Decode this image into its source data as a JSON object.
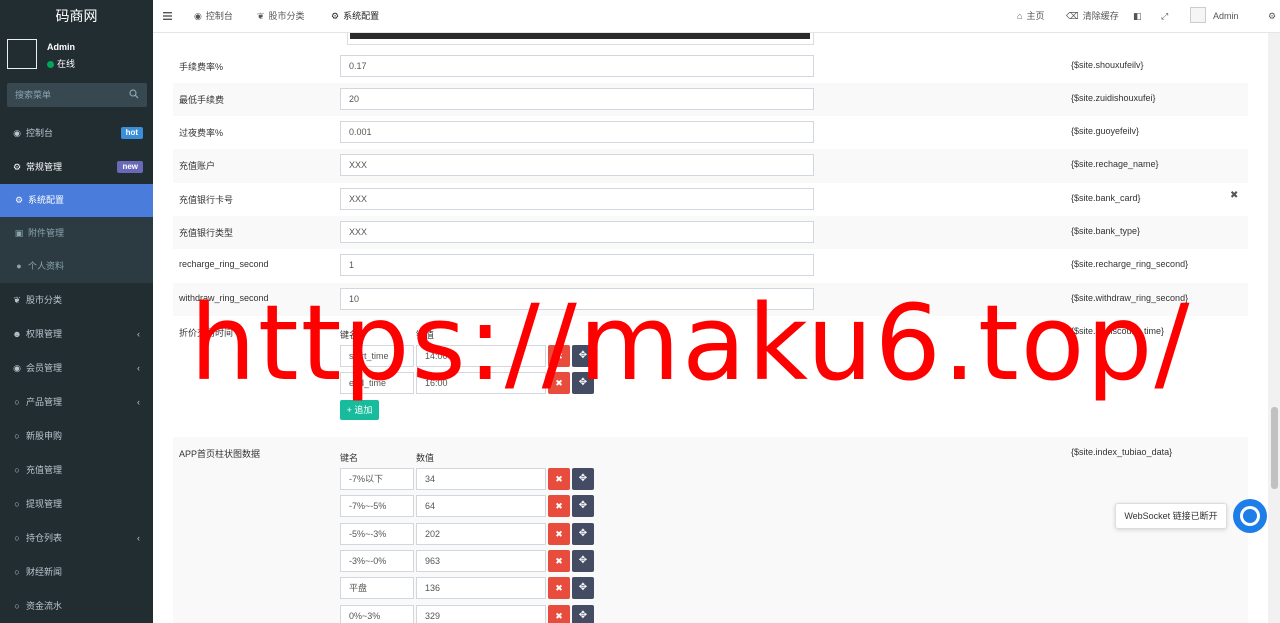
{
  "app": {
    "logo": "码商网"
  },
  "user": {
    "name": "Admin",
    "status": "在线"
  },
  "search": {
    "placeholder": "搜索菜单"
  },
  "sidebar": {
    "items": [
      {
        "label": "控制台",
        "icon": "dashboard-icon",
        "badge": "hot"
      },
      {
        "label": "常规管理",
        "icon": "cogs-icon",
        "badge": "new"
      },
      {
        "label": "系统配置",
        "icon": "gear-icon",
        "active": true,
        "sub": true
      },
      {
        "label": "附件管理",
        "icon": "file-image-icon",
        "sub": true
      },
      {
        "label": "个人资料",
        "icon": "user-icon",
        "sub": true
      },
      {
        "label": "股市分类",
        "icon": "leaf-icon"
      },
      {
        "label": "权限管理",
        "icon": "group-icon",
        "chevron": true
      },
      {
        "label": "会员管理",
        "icon": "user-circle-icon",
        "chevron": true
      },
      {
        "label": "产品管理",
        "icon": "circle-icon",
        "chevron": true
      },
      {
        "label": "新股申购",
        "icon": "circle-icon"
      },
      {
        "label": "充值管理",
        "icon": "circle-icon"
      },
      {
        "label": "提现管理",
        "icon": "circle-icon"
      },
      {
        "label": "持仓列表",
        "icon": "circle-icon",
        "chevron": true
      },
      {
        "label": "财经新闻",
        "icon": "circle-icon"
      },
      {
        "label": "资金流水",
        "icon": "circle-icon"
      }
    ]
  },
  "header": {
    "tabs": [
      {
        "label": "控制台",
        "icon": "dashboard-icon"
      },
      {
        "label": "股市分类",
        "icon": "leaf-icon"
      },
      {
        "label": "系统配置",
        "icon": "gear-icon"
      }
    ],
    "home_label": "主页",
    "clear_cache_label": "清除缓存",
    "admin_label": "Admin"
  },
  "config_rows": [
    {
      "label": "手续费率%",
      "value": "0.17",
      "var": "{$site.shouxufeilv}"
    },
    {
      "label": "最低手续费",
      "value": "20",
      "var": "{$site.zuidishouxufei}"
    },
    {
      "label": "过夜费率%",
      "value": "0.001",
      "var": "{$site.guoyefeilv}"
    },
    {
      "label": "充值账户",
      "value": "XXX",
      "var": "{$site.rechage_name}"
    },
    {
      "label": "充值银行卡号",
      "value": "XXX",
      "var": "{$site.bank_card}"
    },
    {
      "label": "充值银行类型",
      "value": "XXX",
      "var": "{$site.bank_type}"
    },
    {
      "label": "recharge_ring_second",
      "value": "1",
      "var": "{$site.recharge_ring_second}"
    },
    {
      "label": "withdraw_ring_second",
      "value": "10",
      "var": "{$site.withdraw_ring_second}"
    }
  ],
  "discount_time": {
    "label": "折价交易时间",
    "var": "{$site.a_discount_time}",
    "key_header": "键名",
    "value_header": "键值",
    "items": [
      {
        "key": "start_time",
        "value": "14:00"
      },
      {
        "key": "end_time",
        "value": "16:00"
      }
    ],
    "add_label": "追加"
  },
  "tubiao_data": {
    "label": "APP首页柱状图数据",
    "var": "{$site.index_tubiao_data}",
    "key_header": "键名",
    "value_header": "数值",
    "items": [
      {
        "key": "-7%以下",
        "value": "34"
      },
      {
        "key": "-7%~-5%",
        "value": "64"
      },
      {
        "key": "-5%~-3%",
        "value": "202"
      },
      {
        "key": "-3%~-0%",
        "value": "963"
      },
      {
        "key": "平盘",
        "value": "136"
      },
      {
        "key": "0%~3%",
        "value": "329"
      }
    ]
  },
  "websocket": {
    "status_text": "WebSocket 链接已断开"
  },
  "watermark": "https://maku6.top/",
  "colors": {
    "sidebar_bg": "#222d32",
    "active_item": "#4a7cdb",
    "delete_button": "#e74c3c",
    "move_button": "#444c63",
    "add_button": "#18bc9c",
    "watermark": "#ff0000"
  }
}
